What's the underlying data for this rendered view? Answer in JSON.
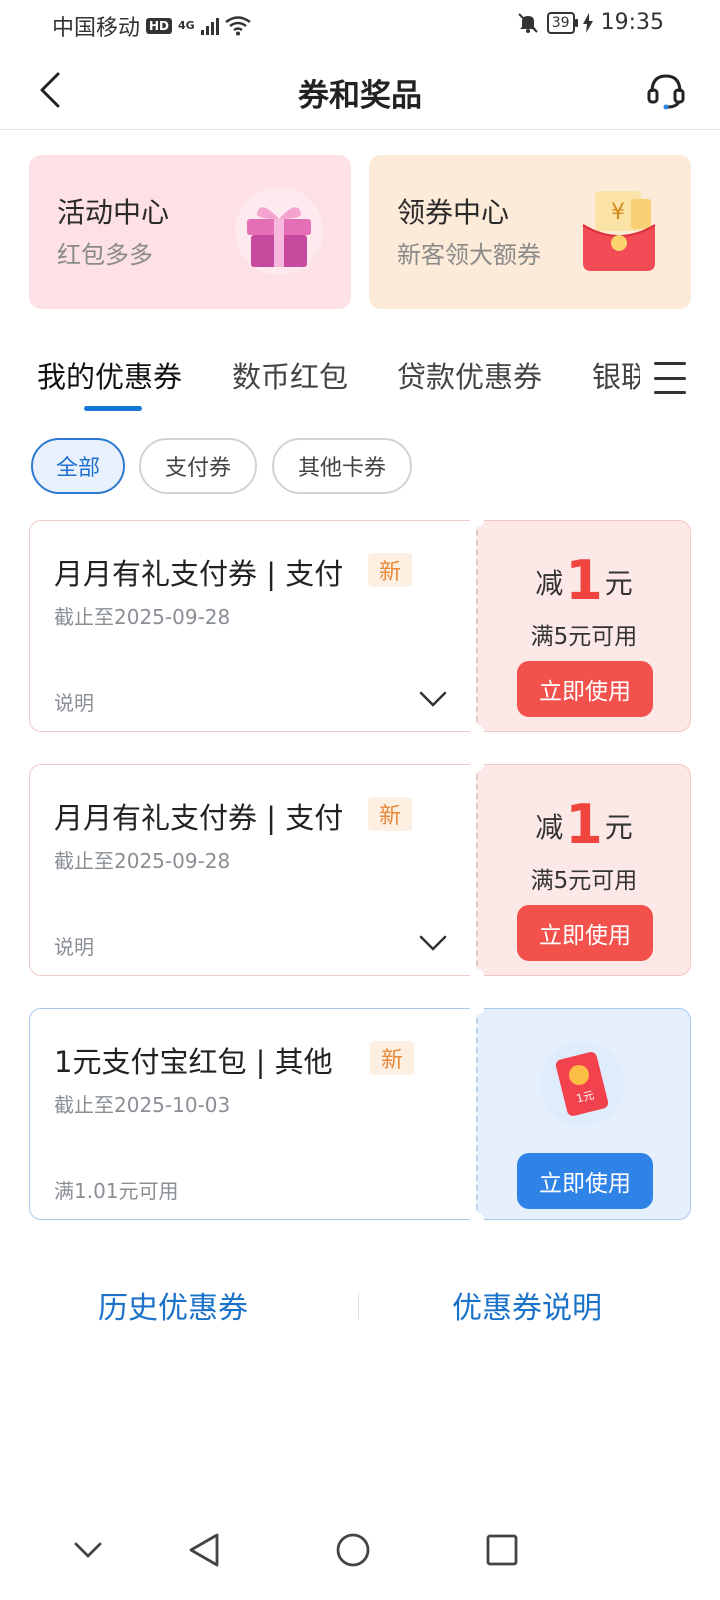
{
  "status_bar": {
    "carrier": "中国移动",
    "hd": "HD",
    "network": "4G",
    "battery": "39",
    "time": "19:35"
  },
  "header": {
    "title": "券和奖品"
  },
  "banners": [
    {
      "title": "活动中心",
      "subtitle": "红包多多"
    },
    {
      "title": "领券中心",
      "subtitle": "新客领大额券"
    }
  ],
  "tabs": [
    "我的优惠券",
    "数币红包",
    "贷款优惠券",
    "银联优惠"
  ],
  "filters": [
    "全部",
    "支付券",
    "其他卡券"
  ],
  "coupons": [
    {
      "title": "月月有礼支付券 | 支付",
      "badge": "新",
      "expiry": "截止至2025-09-28",
      "note": "说明",
      "amount_prefix": "减",
      "amount": "1",
      "amount_unit": "元",
      "condition": "满5元可用",
      "button": "立即使用"
    },
    {
      "title": "月月有礼支付券 | 支付",
      "badge": "新",
      "expiry": "截止至2025-09-28",
      "note": "说明",
      "amount_prefix": "减",
      "amount": "1",
      "amount_unit": "元",
      "condition": "满5元可用",
      "button": "立即使用"
    },
    {
      "title": "1元支付宝红包 |  其他",
      "badge": "新",
      "expiry": "截止至2025-10-03",
      "note": "满1.01元可用",
      "redpack_label": "1元",
      "button": "立即使用"
    }
  ],
  "footer": {
    "history": "历史优惠券",
    "explain": "优惠券说明"
  },
  "colors": {
    "accent_blue": "#1677d6",
    "coupon_red": "#f2514c",
    "badge_orange": "#e9893a"
  }
}
